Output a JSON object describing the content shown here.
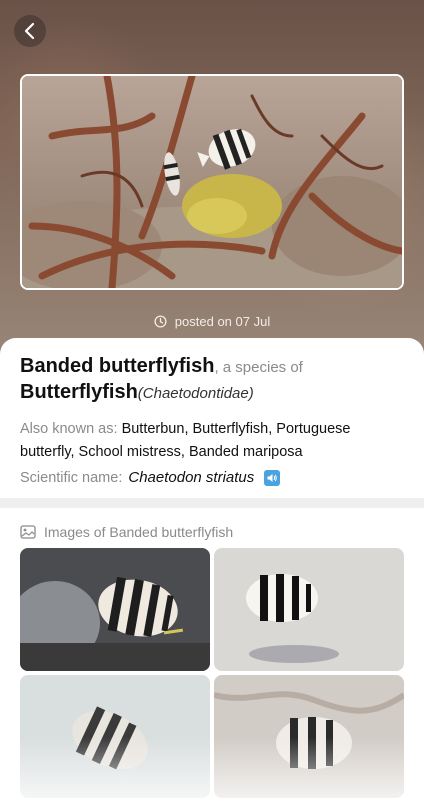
{
  "post": {
    "posted_text": "posted on 07 Jul"
  },
  "species": {
    "common_name": "Banded butterflyfish",
    "species_of_text": ", a species of",
    "family_common": "Butterflyfish",
    "family_latin": "(Chaetodontidae)",
    "aka_label": "Also known as: ",
    "aka_value": "Butterbun, Butterflyfish, Portuguese butterfly, School mistress, Banded mariposa",
    "scientific_label": "Scientific name: ",
    "scientific_value": "Chaetodon striatus"
  },
  "gallery": {
    "heading": "Images of Banded butterflyfish"
  },
  "icons": {
    "back": "chevron-left-icon",
    "clock": "clock-icon",
    "speaker": "speaker-icon",
    "images": "image-gallery-icon"
  },
  "colors": {
    "accent": "#4aa3df",
    "hero_bg": "#7c6456"
  }
}
